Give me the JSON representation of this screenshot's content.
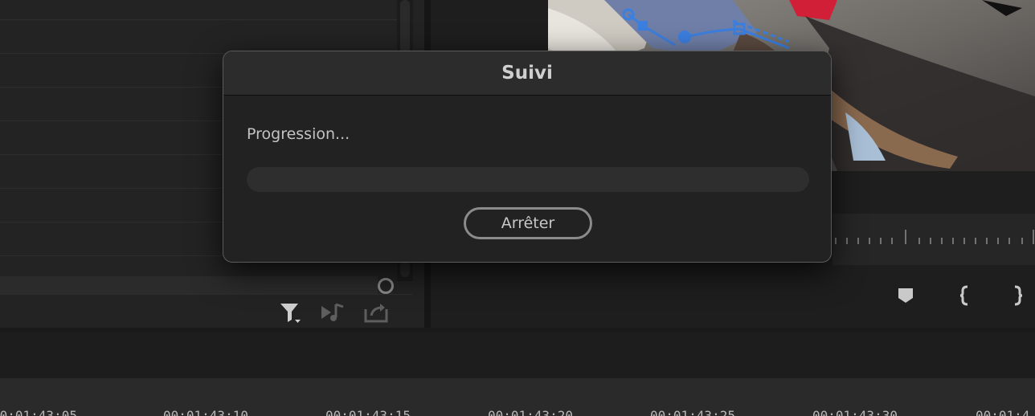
{
  "dialog": {
    "title": "Suivi",
    "status": "Progression...",
    "progress": 0,
    "stop_label": "Arrêter"
  },
  "source_panel": {
    "tools": [
      "filter-icon",
      "automate-to-sequence-icon",
      "export-icon"
    ]
  },
  "program_monitor": {
    "buttons": [
      "add-marker-icon",
      "mark-in-icon",
      "mark-out-icon"
    ]
  },
  "timeline": {
    "timecodes": [
      "00:01:43:05",
      "00:01:43:10",
      "00:01:43:15",
      "00:01:43:20",
      "00:01:43:25",
      "00:01:43:30",
      "00:01:4"
    ]
  },
  "colors": {
    "tracking_path": "#3b7fe0",
    "dialog_bg": "#222222"
  }
}
